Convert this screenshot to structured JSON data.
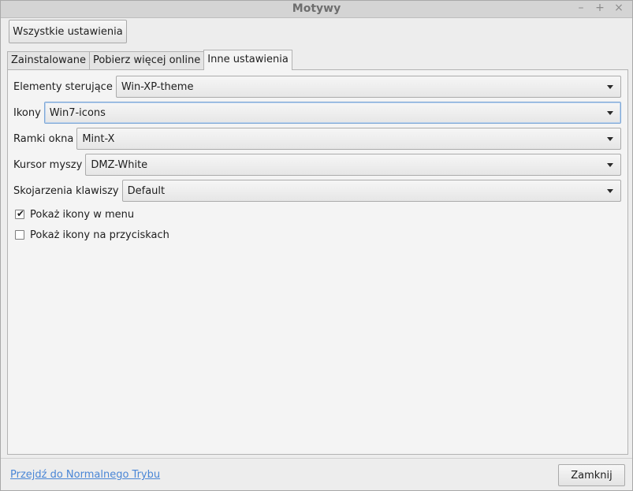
{
  "window": {
    "title": "Motywy",
    "controls": {
      "minimize": "–",
      "maximize": "+",
      "close": "×"
    }
  },
  "toolbar": {
    "all_settings_label": "Wszystkie ustawienia"
  },
  "tabs": [
    {
      "label": "Zainstalowane",
      "active": false
    },
    {
      "label": "Pobierz więcej online",
      "active": false
    },
    {
      "label": "Inne ustawienia",
      "active": true
    }
  ],
  "settings": {
    "controls": {
      "label": "Elementy sterujące",
      "value": "Win-XP-theme"
    },
    "icons": {
      "label": "Ikony",
      "value": "Win7-icons"
    },
    "window_borders": {
      "label": "Ramki okna",
      "value": "Mint-X"
    },
    "mouse_cursor": {
      "label": "Kursor myszy",
      "value": "DMZ-White"
    },
    "key_bindings": {
      "label": "Skojarzenia klawiszy",
      "value": "Default"
    },
    "show_menu_icons": {
      "label": "Pokaż ikony w menu",
      "checked": true
    },
    "show_button_icons": {
      "label": "Pokaż ikony na przyciskach",
      "checked": false
    }
  },
  "footer": {
    "normal_mode_link": "Przejdź do Normalnego Trybu",
    "close_label": "Zamknij"
  },
  "colors": {
    "link": "#4a86d6",
    "focus": "#7fa8d6"
  }
}
